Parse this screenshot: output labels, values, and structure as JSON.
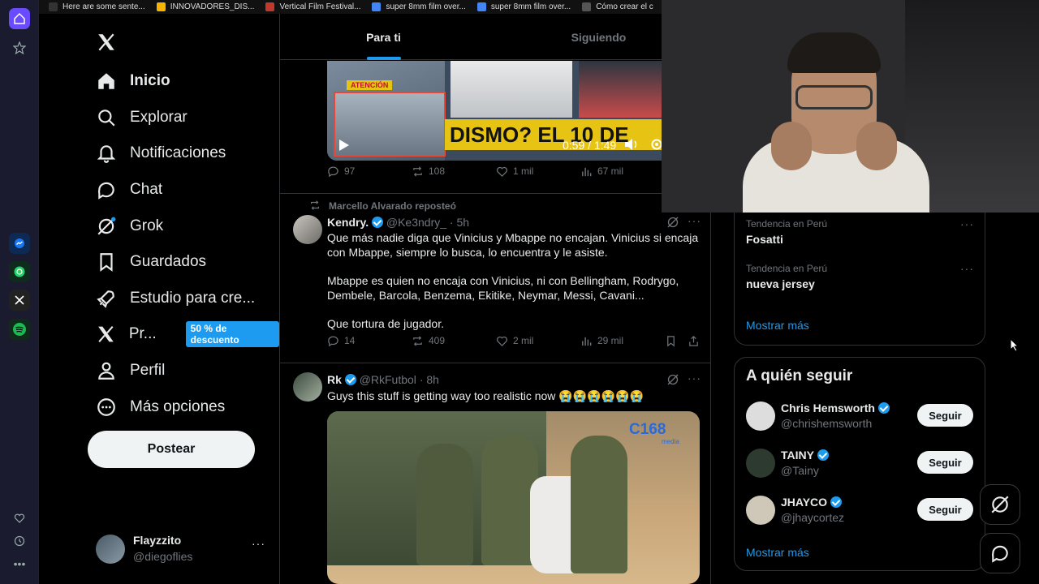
{
  "bookmarks": [
    {
      "label": "Here are some sente...",
      "icon": "number-3-icon",
      "color": "#333333"
    },
    {
      "label": "INNOVADORES_DIS...",
      "icon": "google-drive-icon",
      "color": "#f4b400"
    },
    {
      "label": "Vertical Film Festival...",
      "icon": "film-icon",
      "color": "#c0392b"
    },
    {
      "label": "super 8mm film over...",
      "icon": "google-icon",
      "color": "#4285f4"
    },
    {
      "label": "super 8mm film over...",
      "icon": "google-icon",
      "color": "#4285f4"
    },
    {
      "label": "Cómo crear el c",
      "icon": "blank-icon",
      "color": "#555555"
    }
  ],
  "nav": {
    "items": [
      {
        "label": "Inicio",
        "icon": "home-icon"
      },
      {
        "label": "Explorar",
        "icon": "search-icon"
      },
      {
        "label": "Notificaciones",
        "icon": "bell-icon"
      },
      {
        "label": "Chat",
        "icon": "chat-icon"
      },
      {
        "label": "Grok",
        "icon": "grok-icon"
      },
      {
        "label": "Guardados",
        "icon": "bookmark-icon"
      },
      {
        "label": "Estudio para cre...",
        "icon": "rocket-icon"
      },
      {
        "label": "Pr...",
        "icon": "x-logo-icon",
        "badge": "50 % de descuento"
      },
      {
        "label": "Perfil",
        "icon": "person-icon"
      },
      {
        "label": "Más opciones",
        "icon": "more-circle-icon"
      }
    ],
    "post_label": "Postear",
    "account": {
      "name": "Flayzzito",
      "handle": "@diegoflies"
    }
  },
  "feed": {
    "tabs": [
      "Para ti",
      "Siguiendo"
    ],
    "video": {
      "time": "0:59 / 1:49",
      "banner": "DISMO? EL 10 DE",
      "tag": "ATENCIÓN"
    },
    "video_tweet_stats": {
      "replies": "97",
      "retweets": "108",
      "likes": "1 mil",
      "views": "67 mil"
    },
    "tweet1": {
      "repost_note": "Marcello Alvarado reposteó",
      "name": "Kendry.",
      "handle": "@Ke3ndry_",
      "time": "· 5h",
      "p1": "Que más nadie diga que Vinicius y Mbappe no encajan. Vinicius si encaja con Mbappe, siempre lo busca, lo encuentra y le asiste.",
      "p2": "Mbappe es quien no encaja con Vinicius, ni con Bellingham, Rodrygo, Dembele, Barcola, Benzema, Ekitike, Neymar, Messi, Cavani...",
      "p3": "Que tortura de jugador.",
      "replies": "14",
      "retweets": "409",
      "likes": "2 mil",
      "views": "29 mil"
    },
    "tweet2": {
      "name": "Rk",
      "handle": "@RkFutbol",
      "time": "· 8h",
      "text": "Guys this stuff is getting way too realistic now 😭😭😭😭😭😭",
      "watermark": "C168",
      "watermark_sub": "media"
    }
  },
  "trends": [
    {
      "context": "Tendencia en Perú",
      "name": "Fosatti"
    },
    {
      "context": "Tendencia en Perú",
      "name": "nueva jersey"
    }
  ],
  "show_more": "Mostrar más",
  "who_to_follow": {
    "title": "A quién seguir",
    "follow_label": "Seguir",
    "accounts": [
      {
        "name": "Chris Hemsworth",
        "handle": "@chrishemsworth"
      },
      {
        "name": "TAINY",
        "handle": "@Tainy"
      },
      {
        "name": "JHAYCO",
        "handle": "@jhaycortez"
      }
    ],
    "show_more": "Mostrar más"
  },
  "colors": {
    "accent": "#1d9bf0",
    "text": "#e7e9ea",
    "muted": "#71767b",
    "border": "#2f3336"
  }
}
